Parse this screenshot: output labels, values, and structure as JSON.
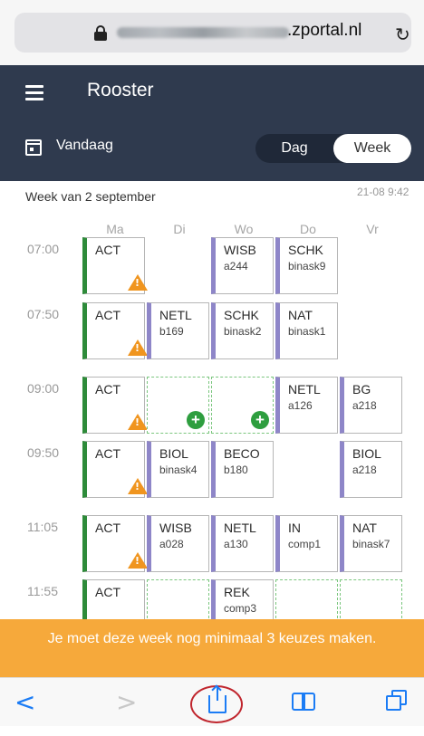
{
  "browser": {
    "domain": ".zportal.nl",
    "reload_icon": "reload-icon"
  },
  "header": {
    "title": "Rooster",
    "today_label": "Vandaag",
    "view_toggle": {
      "day": "Dag",
      "week": "Week",
      "selected": "Week"
    }
  },
  "schedule": {
    "week_label": "Week van 2 september",
    "timestamp": "21-08 9:42",
    "days": [
      "Ma",
      "Di",
      "Wo",
      "Do",
      "Vr"
    ],
    "periods": [
      {
        "time": "07:00",
        "cells": [
          {
            "type": "act",
            "code": "ACT",
            "warning": true
          },
          {
            "type": "empty"
          },
          {
            "type": "lesson",
            "code": "WISB",
            "room": "a244"
          },
          {
            "type": "lesson",
            "code": "SCHK",
            "room": "binask9"
          },
          {
            "type": "empty"
          }
        ]
      },
      {
        "time": "07:50",
        "cells": [
          {
            "type": "act",
            "code": "ACT",
            "warning": true
          },
          {
            "type": "lesson",
            "code": "NETL",
            "room": "b169"
          },
          {
            "type": "lesson",
            "code": "SCHK",
            "room": "binask2"
          },
          {
            "type": "lesson",
            "code": "NAT",
            "room": "binask1"
          },
          {
            "type": "empty"
          }
        ]
      },
      {
        "time": "09:00",
        "cells": [
          {
            "type": "act",
            "code": "ACT",
            "warning": true
          },
          {
            "type": "free",
            "add": true
          },
          {
            "type": "free",
            "add": true
          },
          {
            "type": "lesson",
            "code": "NETL",
            "room": "a126"
          },
          {
            "type": "lesson",
            "code": "BG",
            "room": "a218"
          }
        ]
      },
      {
        "time": "09:50",
        "cells": [
          {
            "type": "act",
            "code": "ACT",
            "warning": true
          },
          {
            "type": "lesson",
            "code": "BIOL",
            "room": "binask4"
          },
          {
            "type": "lesson",
            "code": "BECO",
            "room": "b180"
          },
          {
            "type": "empty"
          },
          {
            "type": "lesson",
            "code": "BIOL",
            "room": "a218"
          }
        ]
      },
      {
        "time": "11:05",
        "cells": [
          {
            "type": "act",
            "code": "ACT",
            "warning": true
          },
          {
            "type": "lesson",
            "code": "WISB",
            "room": "a028"
          },
          {
            "type": "lesson",
            "code": "NETL",
            "room": "a130"
          },
          {
            "type": "lesson",
            "code": "IN",
            "room": "comp1"
          },
          {
            "type": "lesson",
            "code": "NAT",
            "room": "binask7"
          }
        ]
      },
      {
        "time": "11:55",
        "cells": [
          {
            "type": "act",
            "code": "ACT",
            "warning": true
          },
          {
            "type": "free",
            "add": true
          },
          {
            "type": "lesson",
            "code": "REK",
            "room": "comp3"
          },
          {
            "type": "free",
            "add": true
          },
          {
            "type": "free",
            "add": true
          }
        ]
      }
    ]
  },
  "banner": {
    "message": "Je moet deze week nog minimaal 3 keuzes maken."
  },
  "toolbar": {
    "back_icon": "chevron-left-icon",
    "forward_icon": "chevron-right-icon",
    "share_icon": "share-icon",
    "bookmarks_icon": "book-icon",
    "tabs_icon": "tabs-icon"
  },
  "colors": {
    "header_bg": "#2f3a4e",
    "act_bar": "#2e8b3a",
    "lesson_bar": "#8e86c8",
    "warning": "#f0951f",
    "add": "#2e9e3f",
    "banner_bg": "#f6a93b",
    "ios_blue": "#1b7cf5",
    "highlight_ring": "#c0262e"
  }
}
